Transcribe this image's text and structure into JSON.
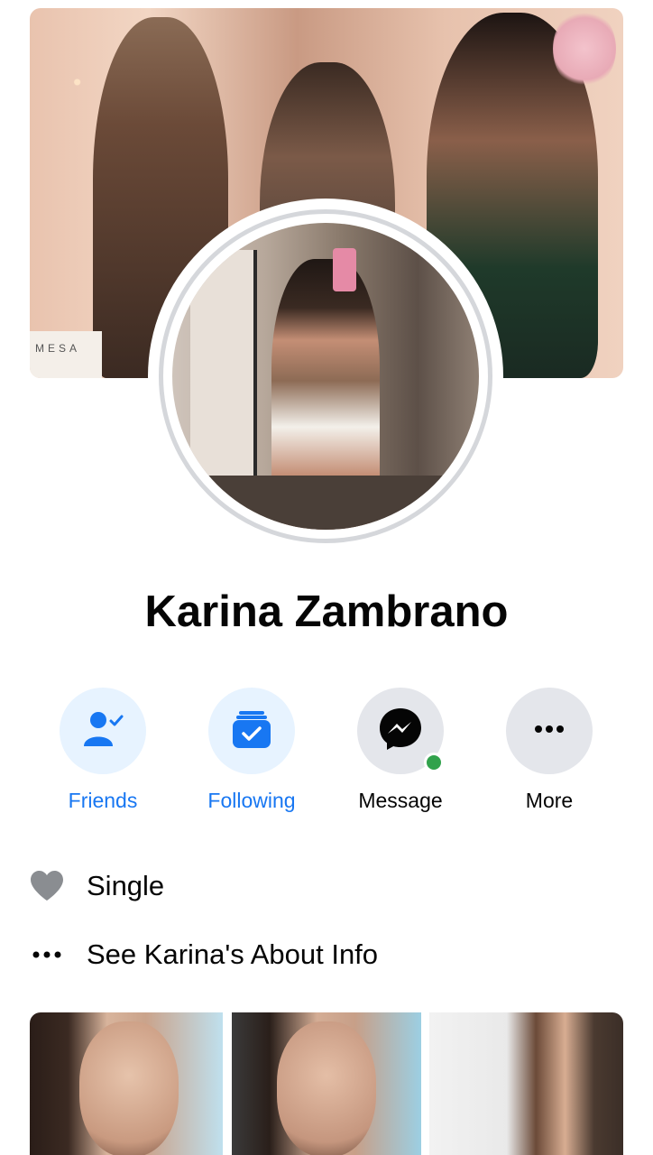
{
  "profile": {
    "name": "Karina Zambrano",
    "cover_sign_text": "MESA"
  },
  "actions": [
    {
      "label": "Friends",
      "icon": "friends-check-icon",
      "style": "blue"
    },
    {
      "label": "Following",
      "icon": "following-check-icon",
      "style": "blue"
    },
    {
      "label": "Message",
      "icon": "messenger-icon",
      "style": "gray",
      "online": true
    },
    {
      "label": "More",
      "icon": "more-dots-icon",
      "style": "gray"
    }
  ],
  "info": {
    "relationship": "Single",
    "about_link": "See Karina's About Info"
  },
  "colors": {
    "accent": "#1877f2",
    "accent_bg": "#e7f3ff",
    "gray_bg": "#e4e6eb",
    "online": "#31a24c",
    "heart": "#8a8d91"
  },
  "photos": [
    "photo-1",
    "photo-2",
    "photo-3"
  ]
}
